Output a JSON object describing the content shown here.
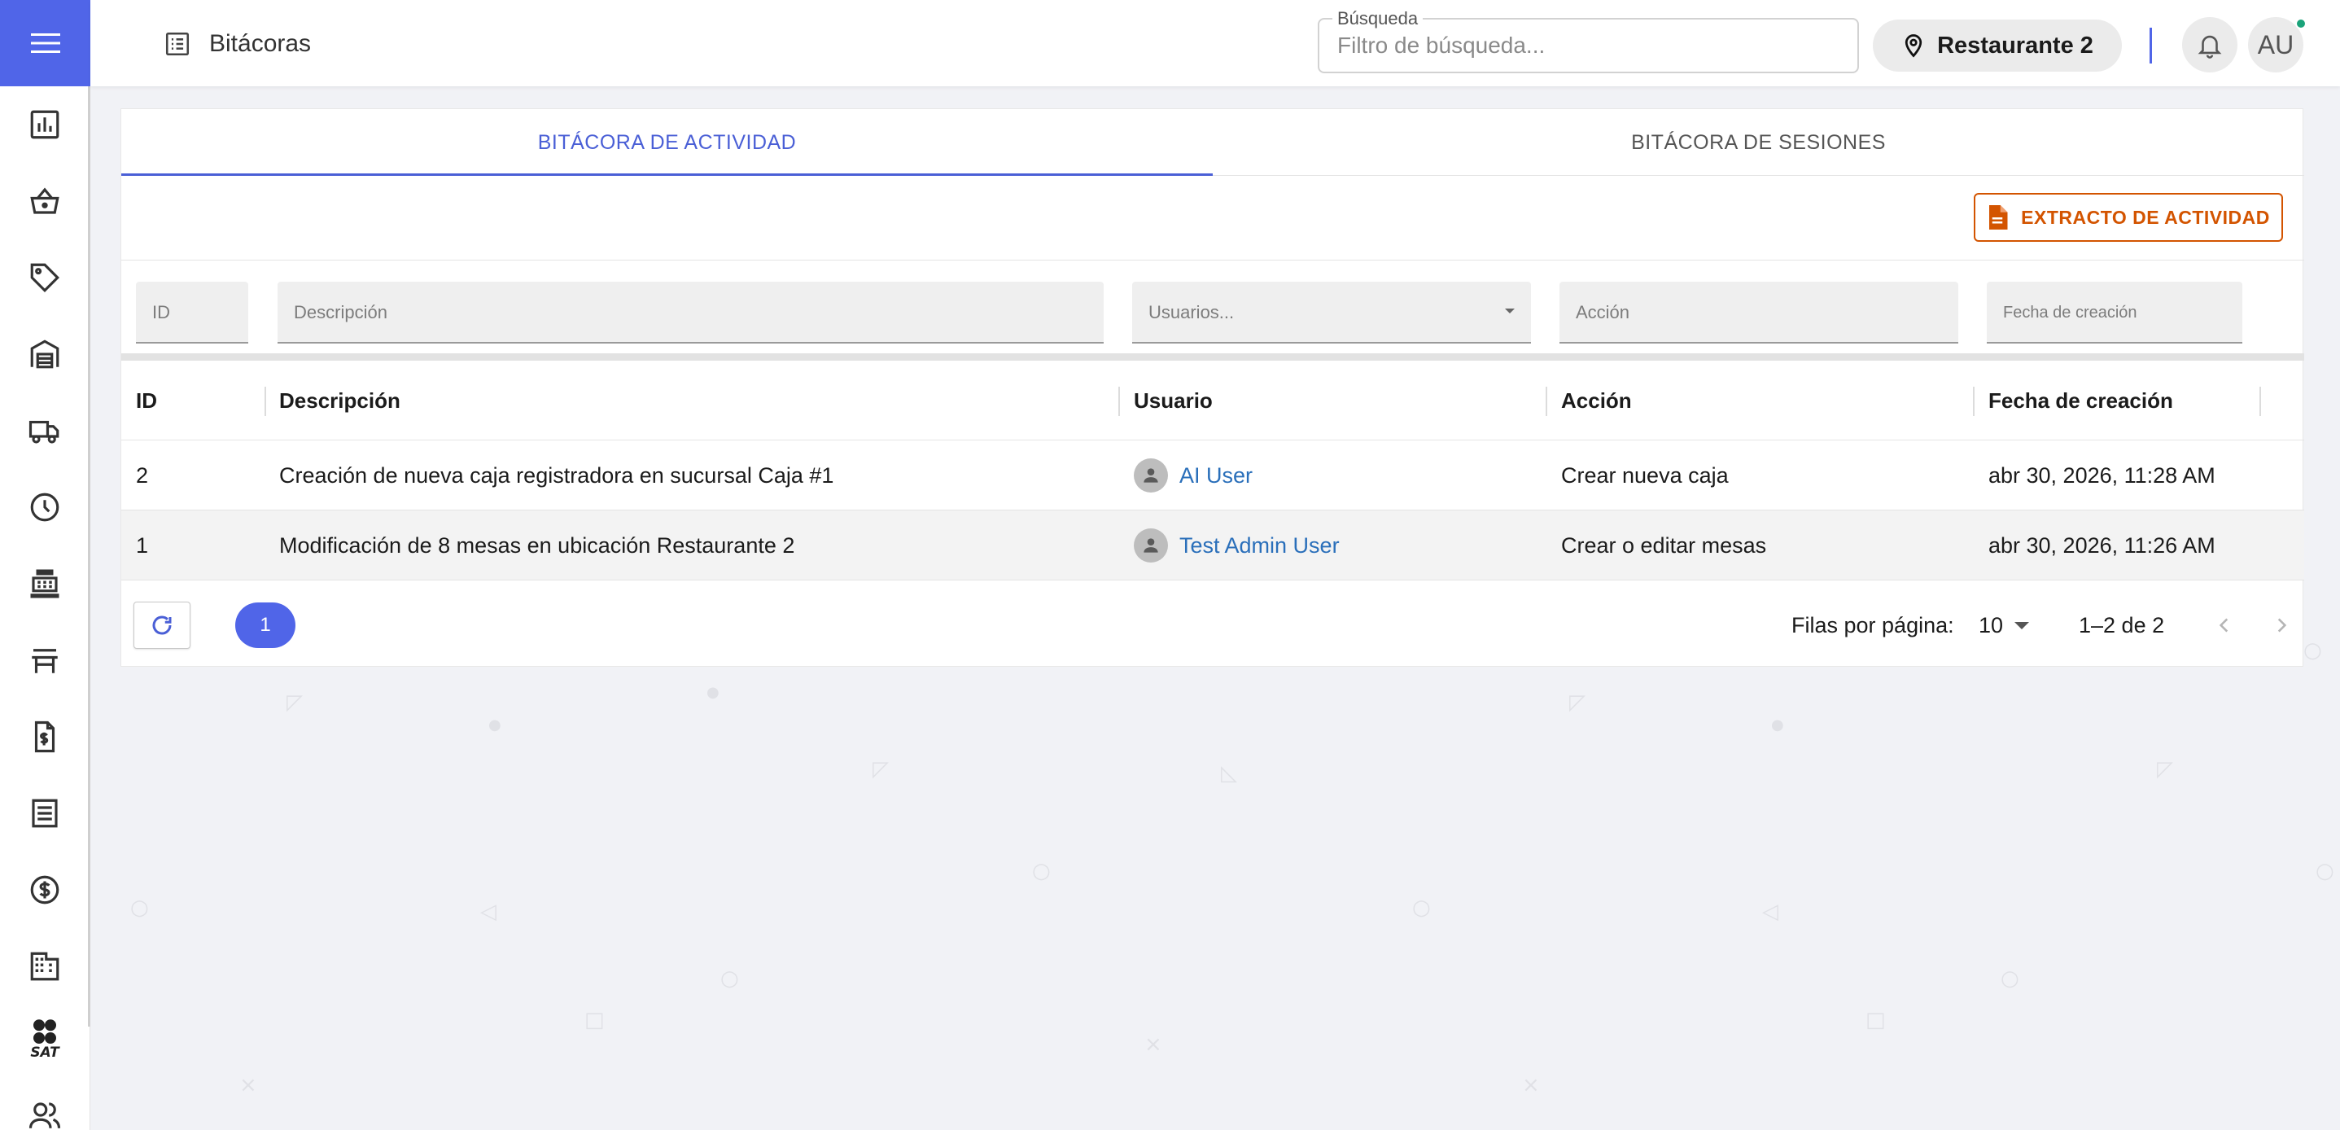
{
  "header": {
    "title": "Bitácoras",
    "search": {
      "legend": "Búsqueda",
      "placeholder": "Filtro de búsqueda..."
    },
    "location": "Restaurante 2",
    "avatar_initials": "AU"
  },
  "sidebar": {
    "items": [
      {
        "icon": "chart-icon"
      },
      {
        "icon": "basket-icon"
      },
      {
        "icon": "tag-icon"
      },
      {
        "icon": "warehouse-icon"
      },
      {
        "icon": "truck-icon"
      },
      {
        "icon": "clock-icon"
      },
      {
        "icon": "cash-register-icon"
      },
      {
        "icon": "table-furniture-icon"
      },
      {
        "icon": "invoice-icon"
      },
      {
        "icon": "receipt-icon"
      },
      {
        "icon": "dollar-icon"
      },
      {
        "icon": "building-icon"
      },
      {
        "icon": "sat-icon",
        "label": "SAT"
      },
      {
        "icon": "users-icon"
      }
    ]
  },
  "tabs": [
    {
      "label": "BITÁCORA DE ACTIVIDAD",
      "active": true
    },
    {
      "label": "BITÁCORA DE SESIONES",
      "active": false
    }
  ],
  "toolbar": {
    "extract_label": "EXTRACTO DE ACTIVIDAD"
  },
  "filters": {
    "id_placeholder": "ID",
    "description_placeholder": "Descripción",
    "users_placeholder": "Usuarios...",
    "action_placeholder": "Acción",
    "date_placeholder": "Fecha de creación"
  },
  "table": {
    "columns": [
      "ID",
      "Descripción",
      "Usuario",
      "Acción",
      "Fecha de creación"
    ],
    "rows": [
      {
        "id": "2",
        "description": "Creación de nueva caja registradora en sucursal Caja #1",
        "user": "AI User",
        "action": "Crear nueva caja",
        "date": "abr 30, 2026, 11:28 AM"
      },
      {
        "id": "1",
        "description": "Modificación de 8 mesas en ubicación Restaurante 2",
        "user": "Test Admin User",
        "action": "Crear o editar mesas",
        "date": "abr 30, 2026, 11:26 AM"
      }
    ]
  },
  "pagination": {
    "current_page": "1",
    "rows_label": "Filas por página:",
    "rows_per_page": "10",
    "range": "1–2 de 2"
  },
  "colors": {
    "accent": "#5065e8",
    "extract": "#d35400",
    "link": "#2a6fba",
    "online": "#1aa37a"
  }
}
